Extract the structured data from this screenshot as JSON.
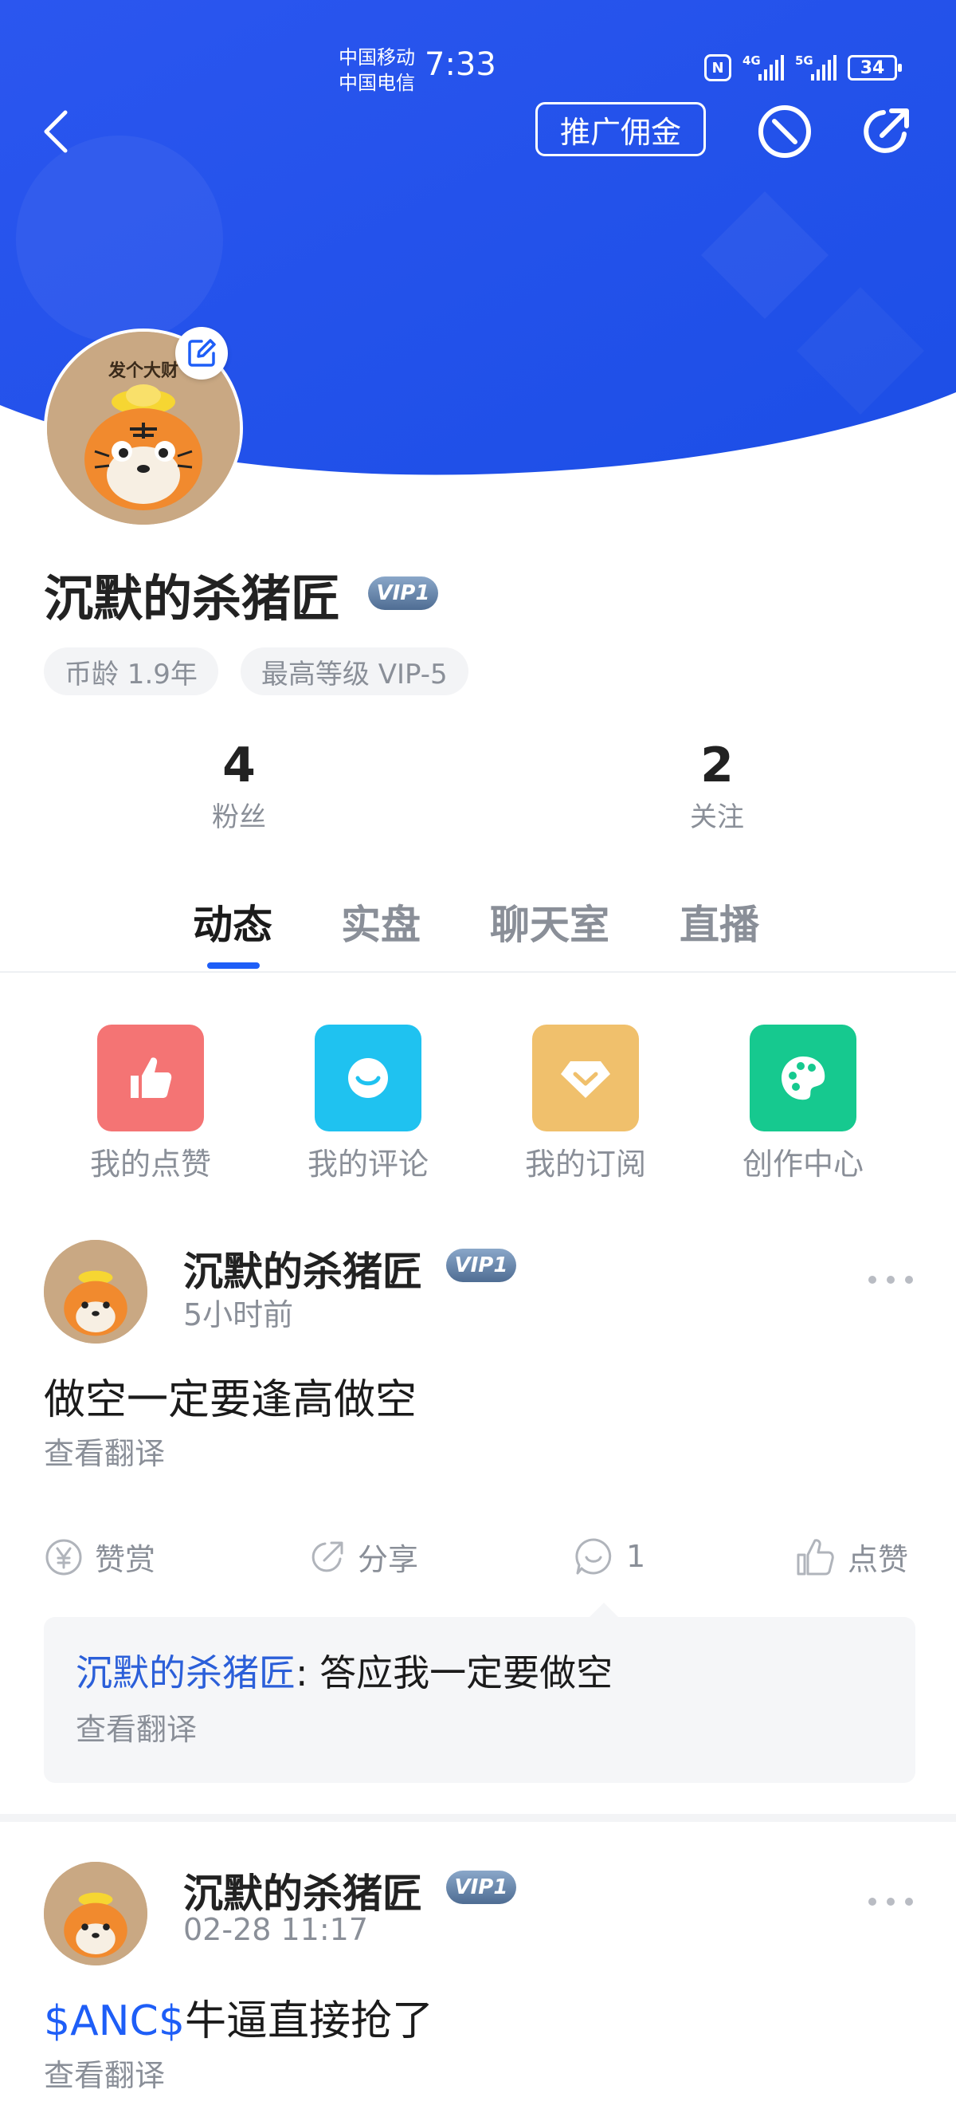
{
  "status_bar": {
    "carrier_1": "中国移动",
    "carrier_2": "中国电信",
    "time": "7:33",
    "nfc": "N",
    "signal_1_tag": "4G",
    "signal_2_tag": "5G",
    "battery": "34"
  },
  "header": {
    "back_icon": "chevron-left-icon",
    "promo_label": "推广佣金",
    "block_icon": "block-icon",
    "share_icon": "share-icon"
  },
  "profile": {
    "name": "沉默的杀猪匠",
    "vip": "VIP1",
    "avatar_caption": "发个大财",
    "chips": [
      "币龄 1.9年",
      "最高等级 VIP-5"
    ],
    "stats": [
      {
        "num": "4",
        "label": "粉丝"
      },
      {
        "num": "2",
        "label": "关注"
      }
    ]
  },
  "tabs": [
    "动态",
    "实盘",
    "聊天室",
    "直播"
  ],
  "quick_actions": [
    {
      "label": "我的点赞",
      "icon": "thumbs-up-icon",
      "color": "#f47474"
    },
    {
      "label": "我的评论",
      "icon": "comment-icon",
      "color": "#1fc2f0"
    },
    {
      "label": "我的订阅",
      "icon": "diamond-icon",
      "color": "#f0c06c"
    },
    {
      "label": "创作中心",
      "icon": "palette-icon",
      "color": "#16c98f"
    }
  ],
  "posts": [
    {
      "author": "沉默的杀猪匠",
      "vip": "VIP1",
      "time": "5小时前",
      "text": "做空一定要逢高做空",
      "translate": "查看翻译",
      "actions": {
        "reward": "赞赏",
        "share": "分享",
        "comment_count": "1",
        "like": "点赞"
      },
      "comment": {
        "author": "沉默的杀猪匠",
        "sep": ": ",
        "text": "答应我一定要做空",
        "translate": "查看翻译"
      }
    },
    {
      "author": "沉默的杀猪匠",
      "vip": "VIP1",
      "time": "02-28 11:17",
      "ticker": "$ANC$",
      "text": "牛逼直接抢了",
      "translate": "查看翻译"
    }
  ],
  "colors": {
    "header_blue": "#2052ee",
    "accent_blue": "#1e5ef7",
    "muted_text": "#8a8f98"
  }
}
